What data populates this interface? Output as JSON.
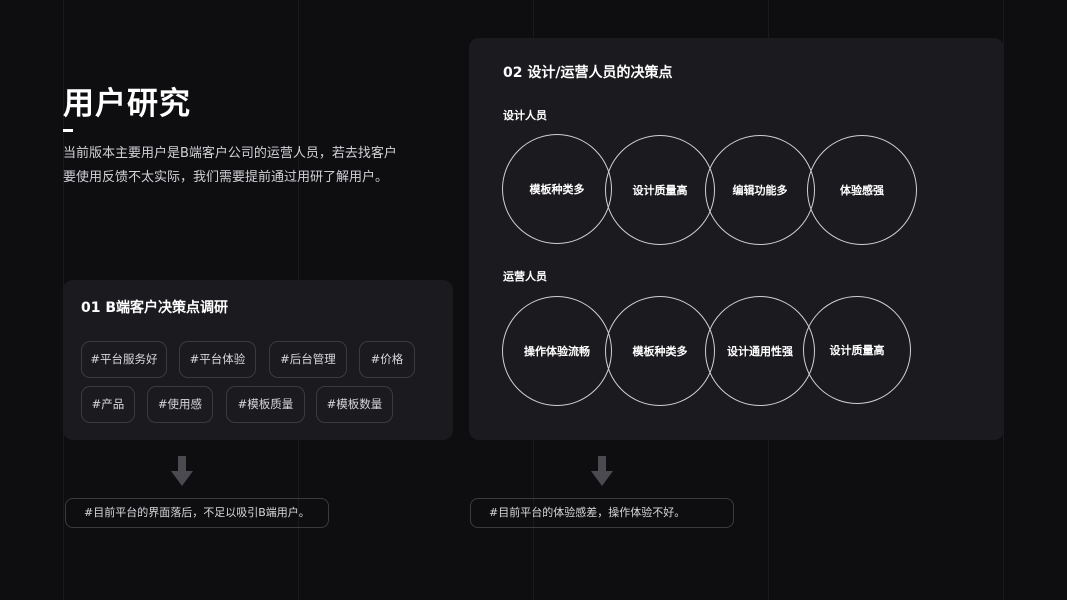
{
  "heading": {
    "title": "用户研究",
    "desc_line1": "当前版本主要用户是B端客户公司的运营人员，若去找客户",
    "desc_line2": "要使用反馈不太实际，我们需要提前通过用研了解用户。"
  },
  "left_card": {
    "title": "01  B端客户决策点调研",
    "tags": [
      "#平台服务好",
      "#平台体验",
      "#后台管理",
      "#价格",
      "#产品",
      "#使用感",
      "#模板质量",
      "#模板数量"
    ],
    "conclusion": "#目前平台的界面落后，不足以吸引B端用户。"
  },
  "right_card": {
    "title": "02  设计/运营人员的决策点",
    "group1": {
      "label": "设计人员",
      "items": [
        "模板种类多",
        "设计质量高",
        "编辑功能多",
        "体验感强"
      ]
    },
    "group2": {
      "label": "运营人员",
      "items": [
        "操作体验流畅",
        "模板种类多",
        "设计通用性强",
        "设计质量高"
      ]
    },
    "conclusion": "#目前平台的体验感差，操作体验不好。"
  },
  "colors": {
    "background": "#0e0e11",
    "card": "#1b1b1f",
    "circle_border": "#d0d0d4",
    "arrow": "#4a4a50"
  },
  "icons": [
    "down-arrow-icon",
    "down-arrow-icon"
  ]
}
